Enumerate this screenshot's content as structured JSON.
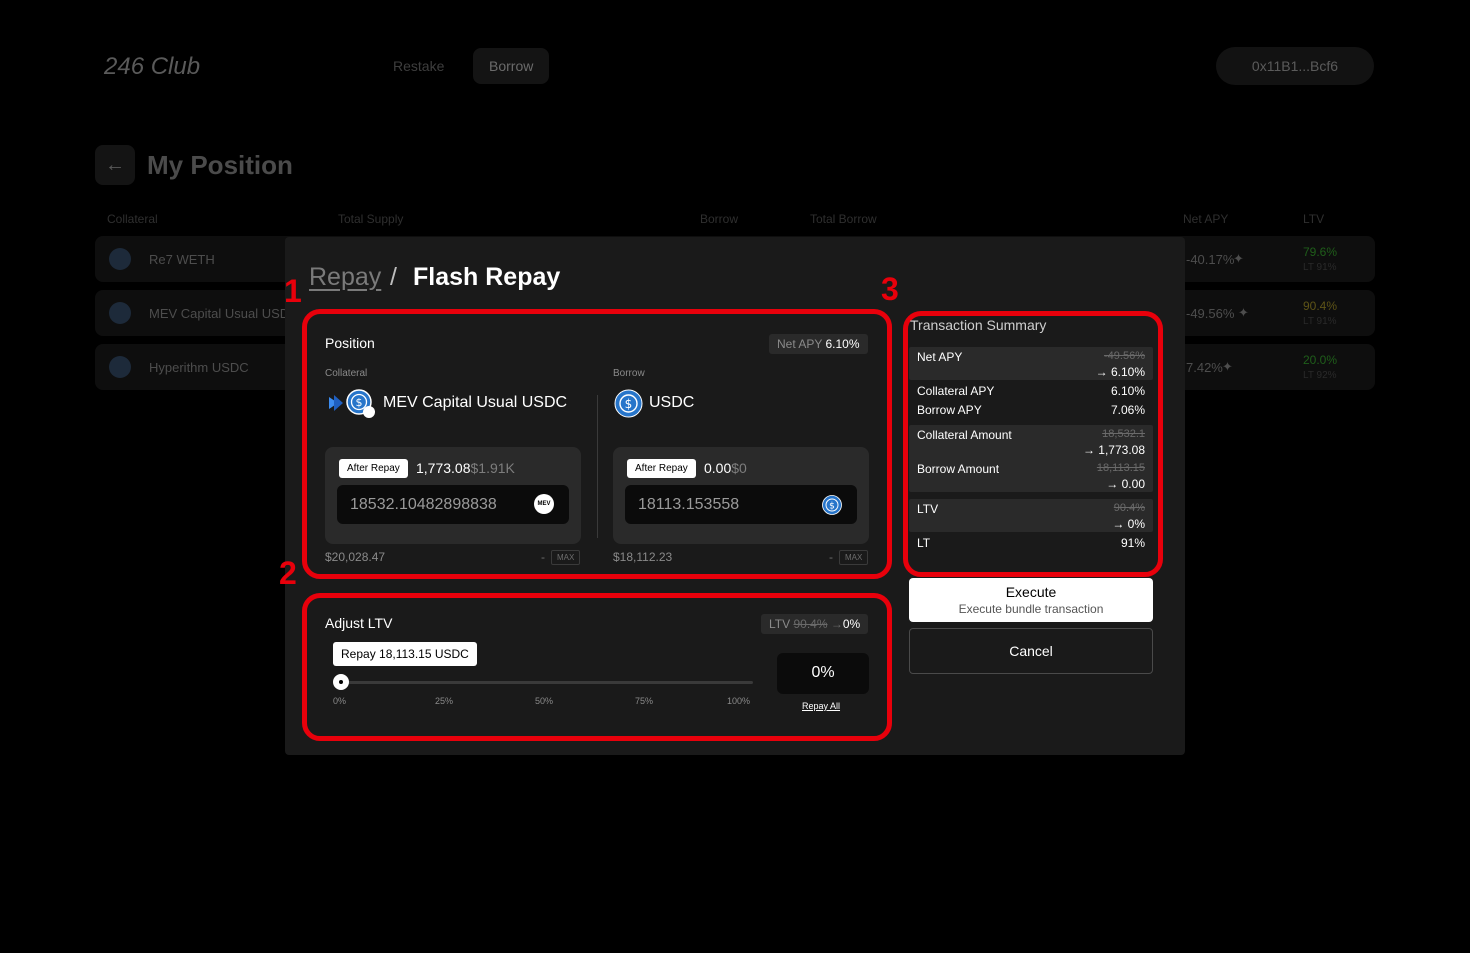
{
  "header": {
    "brand": "246 Club",
    "nav": [
      "Restake",
      "Borrow"
    ],
    "wallet": "0x11B1...Bcf6"
  },
  "page": {
    "title": "My Position",
    "columns": [
      "Collateral",
      "Total Supply",
      "Borrow",
      "Total Borrow",
      "Net APY",
      "LTV"
    ],
    "rows": [
      {
        "name": "Re7 WETH",
        "net_apy": "-40.17%",
        "ltv": "79.6%",
        "lt": "LT 91%"
      },
      {
        "name": "MEV Capital Usual USDC",
        "net_apy": "-49.56%",
        "ltv": "90.4%",
        "lt": "LT 91%"
      },
      {
        "name": "Hyperithm USDC",
        "net_apy": "7.42%",
        "ltv": "20.0%",
        "lt": "LT 92%"
      }
    ]
  },
  "modal": {
    "crumb_repay": "Repay",
    "crumb_sep": "/",
    "crumb_flash": "Flash Repay",
    "markers": [
      "1",
      "2",
      "3"
    ],
    "position": {
      "title": "Position",
      "net_apy_label": "Net APY",
      "net_apy_value": "6.10%",
      "collateral": {
        "label": "Collateral",
        "name": "MEV Capital Usual USDC",
        "after_label": "After Repay",
        "after_value": "1,773.08",
        "after_usd": "$1.91K",
        "amount": "18532.10482898838",
        "usd": "$20,028.47",
        "dash": "-",
        "max": "MAX",
        "icon_text": "MEV"
      },
      "borrow": {
        "label": "Borrow",
        "name": "USDC",
        "after_label": "After Repay",
        "after_value": "0.00",
        "after_usd": "$0",
        "amount": "18113.153558",
        "usd": "$18,112.23",
        "dash": "-",
        "max": "MAX"
      }
    },
    "adjust": {
      "title": "Adjust LTV",
      "ltv_label": "LTV",
      "ltv_old": "90.4%",
      "ltv_arrow": "→",
      "ltv_new": "0%",
      "tooltip": "Repay 18,113.15 USDC",
      "ticks": [
        "0%",
        "25%",
        "50%",
        "75%",
        "100%"
      ],
      "slider_value": 0,
      "percent": "0%",
      "repay_all": "Repay All"
    },
    "summary": {
      "title": "Transaction Summary",
      "net_apy": {
        "label": "Net APY",
        "old": "-49.56%",
        "new": "→ 6.10%"
      },
      "collateral_apy": {
        "label": "Collateral APY",
        "value": "6.10%"
      },
      "borrow_apy": {
        "label": "Borrow APY",
        "value": "7.06%"
      },
      "collateral_amount": {
        "label": "Collateral Amount",
        "old": "18,532.1",
        "new": "→ 1,773.08"
      },
      "borrow_amount": {
        "label": "Borrow Amount",
        "old": "18,113.15",
        "new": "→ 0.00"
      },
      "ltv": {
        "label": "LTV",
        "old": "90.4%",
        "new": "→ 0%"
      },
      "lt": {
        "label": "LT",
        "value": "91%"
      }
    },
    "execute_label": "Execute",
    "execute_sub": "Execute bundle transaction",
    "cancel_label": "Cancel"
  },
  "colors": {
    "highlight": "#e8000b",
    "modal_bg": "#1a1a1a",
    "card_bg": "#2a2a2a",
    "usdc_blue": "#2775ca"
  },
  "icons": [
    "back-arrow-icon",
    "sparkle-icon",
    "mev-token-icon",
    "usdc-icon"
  ]
}
